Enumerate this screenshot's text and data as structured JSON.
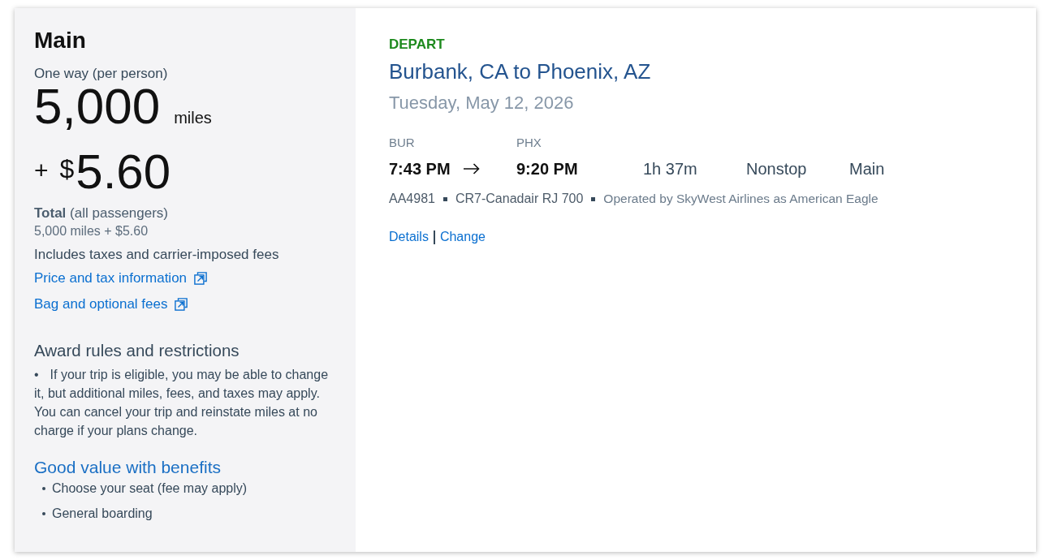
{
  "fare": {
    "cabin": "Main",
    "price_caption": "One way (per person)",
    "miles_amount": "5,000",
    "miles_unit": "miles",
    "plus_sign": "+",
    "currency_symbol": "$",
    "cash_amount": "5.60",
    "total_label": "**Total** (all passengers)",
    "total_value": "5,000 miles + $5.60",
    "fees_note": "Includes taxes and carrier-imposed fees",
    "links": [
      {
        "label": "Price and tax information"
      },
      {
        "label": "Bag and optional fees"
      }
    ]
  },
  "award_rules": {
    "heading": "Award rules and restrictions",
    "marker": "•",
    "text": "If your trip is eligible, you may be able to change it, but additional miles, fees, and taxes may apply. You can cancel your trip and reinstate miles at no charge if your plans change."
  },
  "benefits": {
    "heading": "Good value with benefits",
    "items": [
      "Choose your seat (fee may apply)",
      "General boarding"
    ]
  },
  "flight": {
    "label": "DEPART",
    "route": "Burbank, CA to Phoenix, AZ",
    "date": "Tuesday, May 12, 2026",
    "origin": {
      "code": "BUR",
      "time": "7:43 PM"
    },
    "destination": {
      "code": "PHX",
      "time": "9:20 PM"
    },
    "duration": "1h 37m",
    "stops": "Nonstop",
    "cabin": "Main",
    "flight_number": "AA4981",
    "aircraft": "CR7-Canadair RJ 700",
    "operator": "Operated by SkyWest Airlines as American Eagle",
    "actions": [
      {
        "label": "Details"
      },
      {
        "label": "Change"
      }
    ]
  }
}
